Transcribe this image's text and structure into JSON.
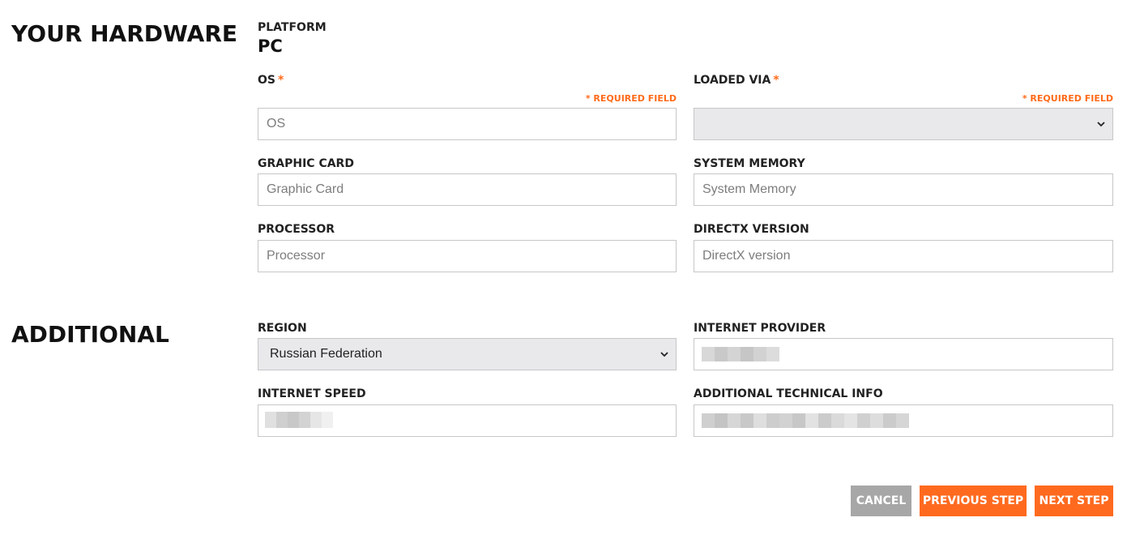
{
  "sections": {
    "hardware_title": "YOUR HARDWARE",
    "additional_title": "ADDITIONAL"
  },
  "platform": {
    "label": "PLATFORM",
    "value": "PC"
  },
  "os": {
    "label": "OS",
    "required_marker": "*",
    "required_note": "* REQUIRED FIELD",
    "placeholder": "OS",
    "value": ""
  },
  "loaded_via": {
    "label": "LOADED VIA",
    "required_marker": "*",
    "required_note": "* REQUIRED FIELD",
    "selected": ""
  },
  "graphic_card": {
    "label": "GRAPHIC CARD",
    "placeholder": "Graphic Card",
    "value": ""
  },
  "system_memory": {
    "label": "SYSTEM MEMORY",
    "placeholder": "System Memory",
    "value": ""
  },
  "processor": {
    "label": "PROCESSOR",
    "placeholder": "Processor",
    "value": ""
  },
  "directx": {
    "label": "DIRECTX VERSION",
    "placeholder": "DirectX version",
    "value": ""
  },
  "region": {
    "label": "REGION",
    "selected": "Russian Federation"
  },
  "internet_provider": {
    "label": "INTERNET PROVIDER"
  },
  "internet_speed": {
    "label": "INTERNET SPEED"
  },
  "additional_info": {
    "label": "ADDITIONAL TECHNICAL INFO"
  },
  "buttons": {
    "cancel": "CANCEL",
    "previous": "PREVIOUS STEP",
    "next": "NEXT STEP"
  },
  "colors": {
    "accent": "#ff6a1f",
    "cancel_bg": "#a7a7a7",
    "select_bg": "#e9e9ec",
    "border": "#c7c7c7"
  },
  "icons": {
    "select_arrow": "chevron-down-icon"
  }
}
